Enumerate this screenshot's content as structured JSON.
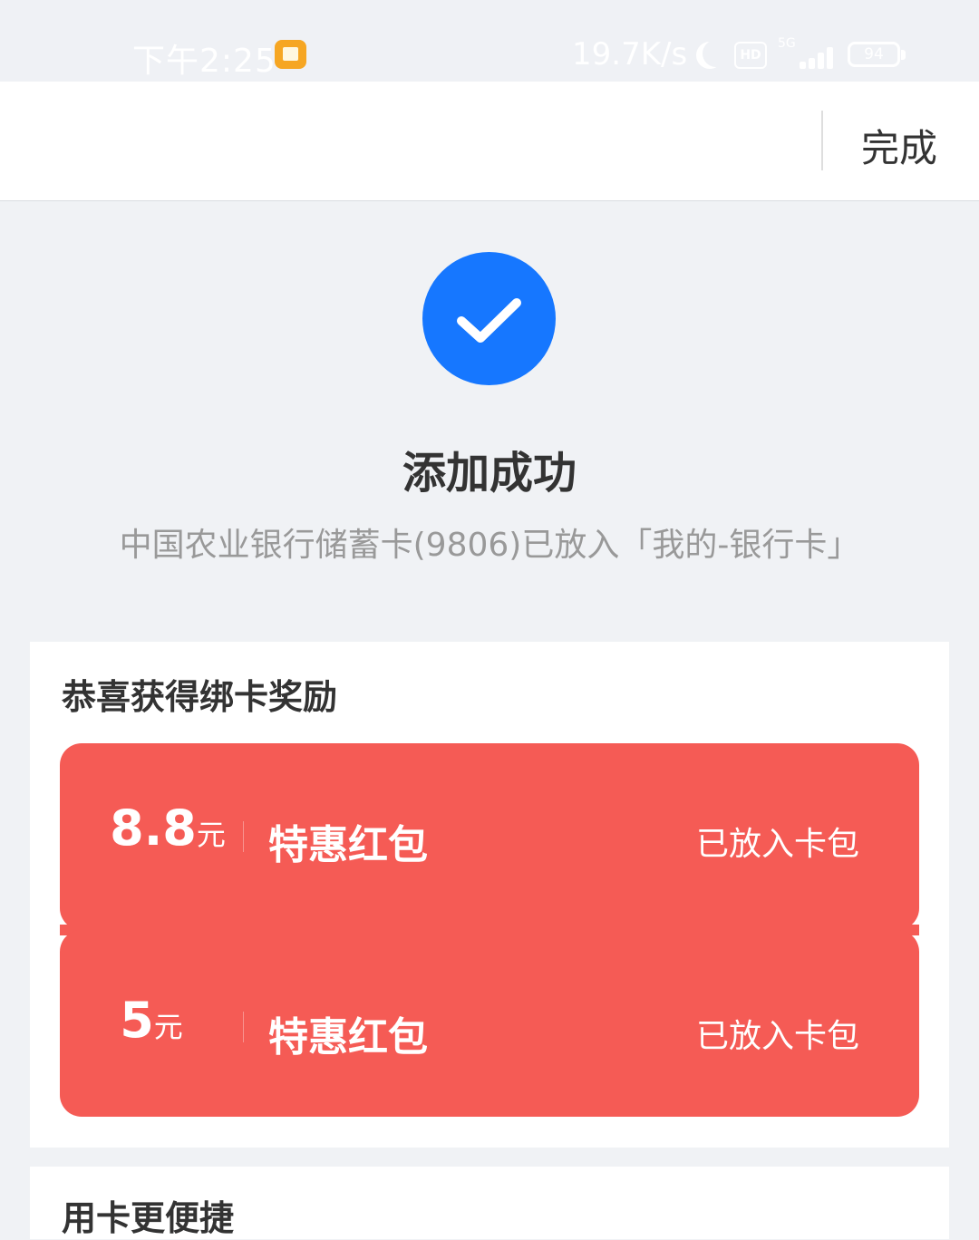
{
  "status_bar": {
    "time": "下午2:25",
    "speed": "19.7K/s",
    "hd": "HD",
    "network": "5G",
    "battery": "94",
    "icons": [
      "app-notification-icon",
      "moon-icon",
      "hd-icon",
      "signal-icon",
      "battery-icon"
    ]
  },
  "nav": {
    "done_label": "完成"
  },
  "success": {
    "icon": "check-circle-icon",
    "icon_color": "#1677ff",
    "title": "添加成功",
    "description": "中国农业银行储蓄卡(9806)已放入「我的-银行卡」"
  },
  "reward": {
    "title": "恭喜获得绑卡奖励",
    "coupon_color": "#f55b55",
    "coupons": [
      {
        "amount": "8.8",
        "unit": "元",
        "name": "特惠红包",
        "status": "已放入卡包"
      },
      {
        "amount": "5",
        "unit": "元",
        "name": "特惠红包",
        "status": "已放入卡包"
      }
    ]
  },
  "next_section": {
    "title": "用卡更便捷"
  }
}
